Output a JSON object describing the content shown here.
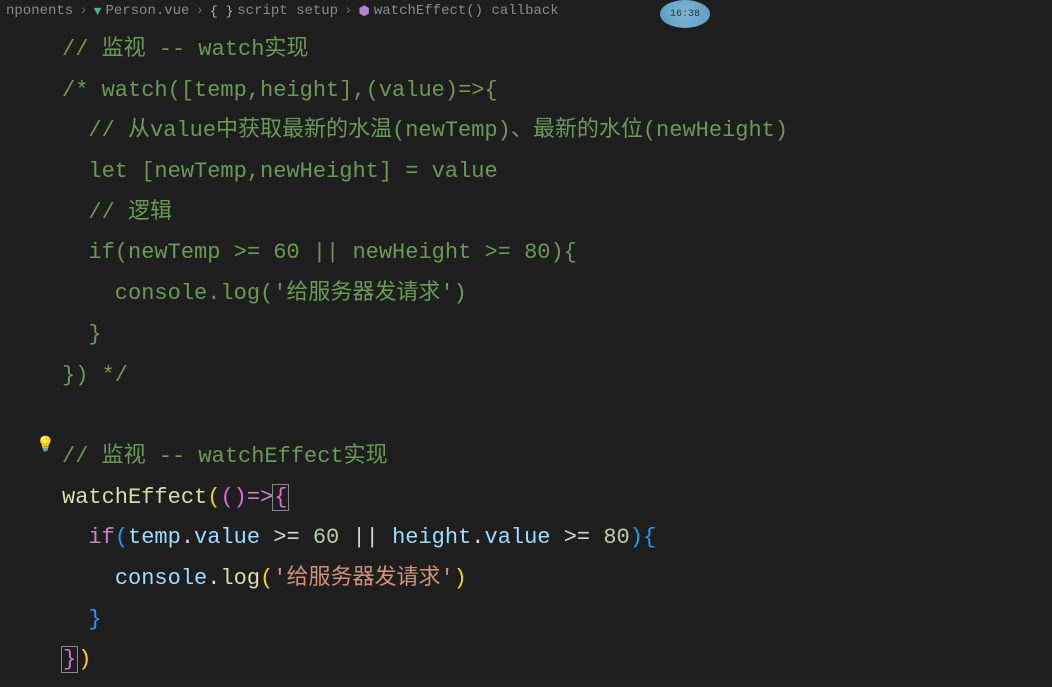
{
  "breadcrumb": {
    "item1": "nponents",
    "item2": "Person.vue",
    "item3": "script setup",
    "item4": "watchEffect() callback"
  },
  "badge": {
    "time": "16:38"
  },
  "code": {
    "l1_comment": "// 监视 -- watch实现",
    "l2_comment_open": "/* watch([temp,height],(value)=>{",
    "l3_comment": "  // 从value中获取最新的水温(newTemp)、最新的水位(newHeight)",
    "l4_comment": "  let [newTemp,newHeight] = value",
    "l5_comment": "  // 逻辑",
    "l6_comment": "  if(newTemp >= 60 || newHeight >= 80){",
    "l7_comment": "    console.log('给服务器发请求')",
    "l8_comment": "  }",
    "l9_comment": "}) */",
    "l10_comment": "// 监视 -- watchEffect实现",
    "l11_func": "watchEffect",
    "l12_if": "if",
    "l12_temp": "temp",
    "l12_value1": "value",
    "l12_num1": "60",
    "l12_height": "height",
    "l12_value2": "value",
    "l12_num2": "80",
    "l13_console": "console",
    "l13_log": "log",
    "l13_str": "'给服务器发请求'"
  }
}
